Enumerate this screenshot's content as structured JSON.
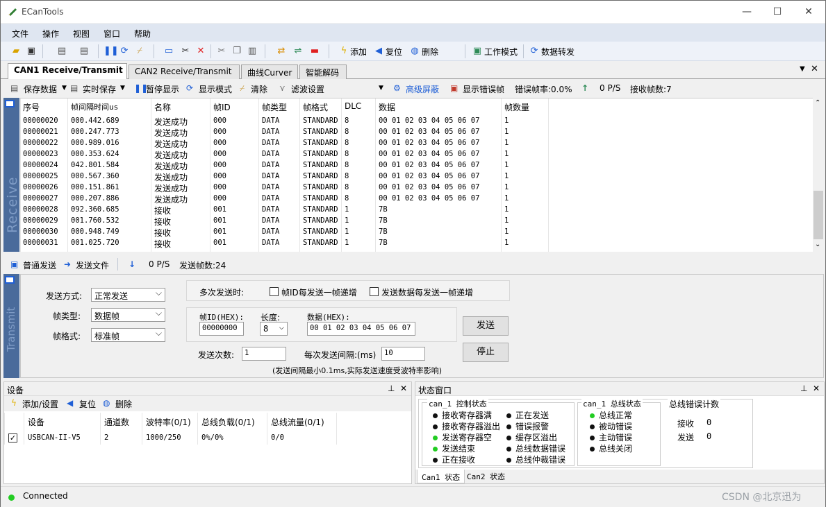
{
  "window": {
    "title": "ECanTools",
    "minimize": "—",
    "maximize": "☐",
    "close": "✕"
  },
  "menu": [
    "文件",
    "操作",
    "视图",
    "窗口",
    "帮助"
  ],
  "toolbar": {
    "add": "添加",
    "reset": "复位",
    "delete": "删除",
    "work_mode": "工作模式",
    "data_forward": "数据转发"
  },
  "tabs": [
    "CAN1 Receive/Transmit",
    "CAN2 Receive/Transmit",
    "曲线Curver",
    "智能解码"
  ],
  "rx_toolbar": {
    "save_data": "保存数据",
    "realtime_save": "实时保存",
    "pause_display": "暂停显示",
    "display_mode": "显示模式",
    "clear": "清除",
    "filter_settings": "滤波设置",
    "advanced_mask": "高级屏蔽",
    "show_error_frames": "显示错误帧",
    "error_rate": "错误帧率:0.0%",
    "rx_rate": "0 P/S",
    "rx_count": "接收帧数:7"
  },
  "rx_side_label": "Receive",
  "rx_columns": [
    "序号",
    "帧间隔时间us",
    "名称",
    "帧ID",
    "帧类型",
    "帧格式",
    "DLC",
    "数据",
    "帧数量"
  ],
  "rx_rows": [
    [
      "00000020",
      "000.442.689",
      "发送成功",
      "000",
      "DATA",
      "STANDARD",
      "8",
      "00 01 02 03 04 05 06 07",
      "1"
    ],
    [
      "00000021",
      "000.247.773",
      "发送成功",
      "000",
      "DATA",
      "STANDARD",
      "8",
      "00 01 02 03 04 05 06 07",
      "1"
    ],
    [
      "00000022",
      "000.989.016",
      "发送成功",
      "000",
      "DATA",
      "STANDARD",
      "8",
      "00 01 02 03 04 05 06 07",
      "1"
    ],
    [
      "00000023",
      "000.353.624",
      "发送成功",
      "000",
      "DATA",
      "STANDARD",
      "8",
      "00 01 02 03 04 05 06 07",
      "1"
    ],
    [
      "00000024",
      "042.801.584",
      "发送成功",
      "000",
      "DATA",
      "STANDARD",
      "8",
      "00 01 02 03 04 05 06 07",
      "1"
    ],
    [
      "00000025",
      "000.567.360",
      "发送成功",
      "000",
      "DATA",
      "STANDARD",
      "8",
      "00 01 02 03 04 05 06 07",
      "1"
    ],
    [
      "00000026",
      "000.151.861",
      "发送成功",
      "000",
      "DATA",
      "STANDARD",
      "8",
      "00 01 02 03 04 05 06 07",
      "1"
    ],
    [
      "00000027",
      "000.207.886",
      "发送成功",
      "000",
      "DATA",
      "STANDARD",
      "8",
      "00 01 02 03 04 05 06 07",
      "1"
    ],
    [
      "00000028",
      "092.360.685",
      "接收",
      "001",
      "DATA",
      "STANDARD",
      "1",
      "7B",
      "1"
    ],
    [
      "00000029",
      "001.760.532",
      "接收",
      "001",
      "DATA",
      "STANDARD",
      "1",
      "7B",
      "1"
    ],
    [
      "00000030",
      "000.948.749",
      "接收",
      "001",
      "DATA",
      "STANDARD",
      "1",
      "7B",
      "1"
    ],
    [
      "00000031",
      "001.025.720",
      "接收",
      "001",
      "DATA",
      "STANDARD",
      "1",
      "7B",
      "1"
    ]
  ],
  "tx_toolbar": {
    "normal_send": "普通发送",
    "send_file": "发送文件",
    "tx_rate": "0 P/S",
    "tx_count": "发送帧数:24"
  },
  "tx_side_label": "Transmit",
  "tx_form": {
    "send_mode_label": "发送方式:",
    "send_mode_value": "正常发送",
    "frame_type_label": "帧类型:",
    "frame_type_value": "数据帧",
    "frame_format_label": "帧格式:",
    "frame_format_value": "标准帧",
    "multi_send_label": "多次发送时:",
    "id_increment": "帧ID每发送一帧递增",
    "data_increment": "发送数据每发送一帧递增",
    "id_label": "帧ID(HEX):",
    "id_value": "00000000",
    "len_label": "长度:",
    "len_value": "8",
    "data_label": "数据(HEX):",
    "data_value": "00 01 02 03 04 05 06 07",
    "count_label": "发送次数:",
    "count_value": "1",
    "interval_label": "每次发送间隔:(ms)",
    "interval_value": "10",
    "note": "(发送间隔最小0.1ms,实际发送速度受波特率影响)",
    "send_button": "发送",
    "stop_button": "停止"
  },
  "device_pane": {
    "title": "设备",
    "add_set": "添加/设置",
    "reset": "复位",
    "delete": "删除",
    "columns": [
      "设备",
      "通道数",
      "波特率(0/1)",
      "总线负载(0/1)",
      "总线流量(0/1)"
    ],
    "rows": [
      [
        "USBCAN-II-V5",
        "2",
        "1000/250",
        "0%/0%",
        "0/0"
      ]
    ]
  },
  "status_pane": {
    "title": "状态窗口",
    "ctrl_title": "can_1 控制状态",
    "ctrl_left": [
      {
        "label": "接收寄存器满",
        "color": "#111111"
      },
      {
        "label": "接收寄存器溢出",
        "color": "#111111"
      },
      {
        "label": "发送寄存器空",
        "color": "#22cc22"
      },
      {
        "label": "发送结束",
        "color": "#22cc22"
      },
      {
        "label": "正在接收",
        "color": "#111111"
      }
    ],
    "ctrl_right": [
      {
        "label": "正在发送",
        "color": "#111111"
      },
      {
        "label": "错误报警",
        "color": "#111111"
      },
      {
        "label": "缓存区溢出",
        "color": "#111111"
      },
      {
        "label": "总线数据错误",
        "color": "#111111"
      },
      {
        "label": "总线仲裁错误",
        "color": "#111111"
      }
    ],
    "bus_title": "can_1 总线状态",
    "bus_items": [
      {
        "label": "总线正常",
        "color": "#22cc22"
      },
      {
        "label": "被动错误",
        "color": "#111111"
      },
      {
        "label": "主动错误",
        "color": "#111111"
      },
      {
        "label": "总线关闭",
        "color": "#111111"
      }
    ],
    "err_title": "总线错误计数",
    "err_rx_label": "接收",
    "err_rx_value": "0",
    "err_tx_label": "发送",
    "err_tx_value": "0",
    "tabs": [
      "Can1 状态",
      "Can2 状态"
    ]
  },
  "statusbar": {
    "text": "Connected",
    "watermark": "CSDN @北京迅为"
  },
  "colors": {
    "connected": "#22cc22",
    "side_panel": "#4a6b9b",
    "link": "#1f5fd6"
  }
}
